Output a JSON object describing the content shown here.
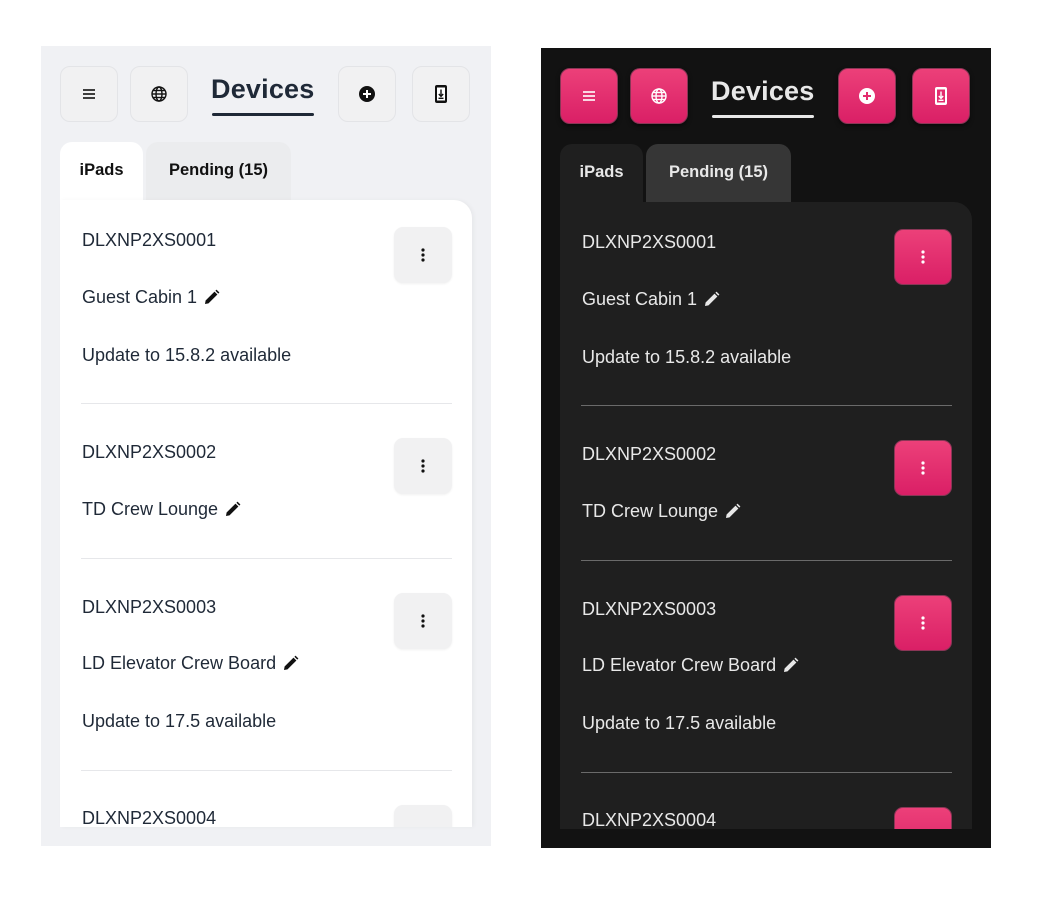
{
  "themes": [
    {
      "id": "light",
      "header": {
        "title": "Devices",
        "buttons": [
          {
            "icon": "menu-icon",
            "label": "Menu"
          },
          {
            "icon": "globe-icon",
            "label": "Language"
          },
          {
            "icon": "add-circle-icon",
            "label": "Add device"
          },
          {
            "icon": "device-download-icon",
            "label": "Download"
          }
        ]
      },
      "tabs": [
        {
          "label": "iPads",
          "active": true
        },
        {
          "label": "Pending (15)",
          "active": false
        }
      ]
    },
    {
      "id": "dark",
      "header": {
        "title": "Devices",
        "buttons": [
          {
            "icon": "menu-icon",
            "label": "Menu"
          },
          {
            "icon": "globe-icon",
            "label": "Language"
          },
          {
            "icon": "add-circle-icon",
            "label": "Add device"
          },
          {
            "icon": "device-download-icon",
            "label": "Download"
          }
        ]
      },
      "tabs": [
        {
          "label": "iPads",
          "active": true
        },
        {
          "label": "Pending (15)",
          "active": false
        }
      ]
    }
  ],
  "devices": [
    {
      "serial": "DLXNP2XS0001",
      "name": "Guest Cabin 1",
      "update": "Update to 15.8.2 available"
    },
    {
      "serial": "DLXNP2XS0002",
      "name": "TD Crew Lounge",
      "update": ""
    },
    {
      "serial": "DLXNP2XS0003",
      "name": "LD Elevator Crew Board",
      "update": "Update to 17.5 available"
    },
    {
      "serial": "DLXNP2XS0004",
      "name": "",
      "update": ""
    }
  ],
  "colors": {
    "accent_pink": "#e32c6e",
    "light_bg": "#f0f1f4",
    "dark_bg": "#121212",
    "dark_card": "#1f1f1f",
    "text_dark": "#1f2937",
    "text_light": "#e8e8e8"
  }
}
